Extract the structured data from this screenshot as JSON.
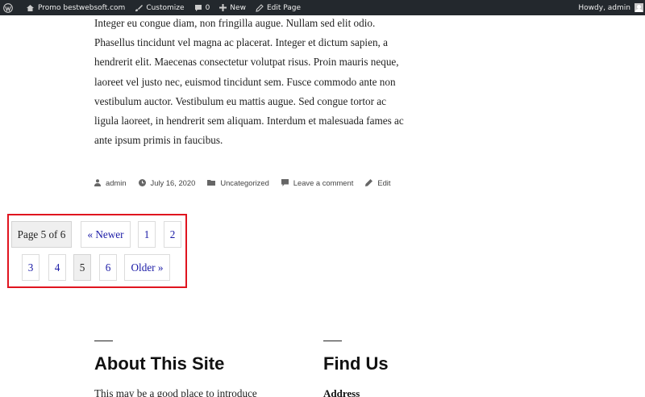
{
  "admin_bar": {
    "site_name": "Promo bestwebsoft.com",
    "customize": "Customize",
    "comments_count": "0",
    "new": "New",
    "edit_page": "Edit Page",
    "howdy": "Howdy, admin"
  },
  "article": {
    "body": "Integer eu congue diam, non fringilla augue. Nullam sed elit odio. Phasellus tincidunt vel magna ac placerat. Integer et dictum sapien, a hendrerit elit. Maecenas consectetur volutpat risus. Proin mauris neque, laoreet vel justo nec, euismod tincidunt sem. Fusce commodo ante non vestibulum auctor. Vestibulum eu mattis augue. Sed congue tortor ac ligula laoreet, in hendrerit sem aliquam. Interdum et malesuada fames ac ante ipsum primis in faucibus."
  },
  "meta": {
    "author": "admin",
    "date": "July 16, 2020",
    "category": "Uncategorized",
    "comment": "Leave a comment",
    "edit": "Edit"
  },
  "pagination": {
    "page_info": "Page 5 of 6",
    "newer": "« Newer",
    "pages": [
      "1",
      "2",
      "3",
      "4",
      "5",
      "6"
    ],
    "current": "5",
    "older": "Older »"
  },
  "footer": {
    "about_title": "About This Site",
    "about_text": "This may be a good place to introduce",
    "find_title": "Find Us",
    "address_label": "Address"
  },
  "colors": {
    "admin_bar_bg": "#23282d",
    "link": "#1a1aa6",
    "highlight_border": "#e0141f"
  }
}
